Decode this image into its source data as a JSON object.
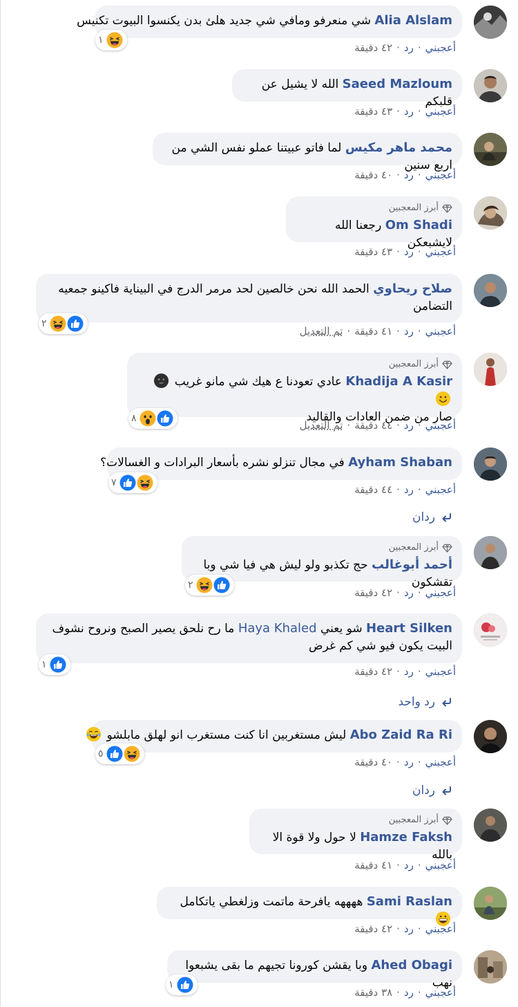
{
  "labels": {
    "top_fan": "أبرز المعجبين",
    "like": "أعجبني",
    "reply": "رد",
    "dot": "·",
    "edited": "تم التعديل"
  },
  "colors": {
    "link": "#385898",
    "bubble": "#f0f2f5",
    "meta": "#65676b",
    "like_blue": "#1877f2",
    "haha_yellow": "#f7b125"
  },
  "comments": [
    {
      "author": "Alia Alslam",
      "text": "شي منعرفو ومافي شي جديد هلئ بدن يكنسوا البيوت تكنيس",
      "time": "٤٢ دقيقة",
      "reactions": [
        "haha-icon"
      ],
      "count": "١"
    },
    {
      "author": "Saeed Mazloum",
      "text": "الله لا يشيل عن قلبكم",
      "time": "٤٣ دقيقة"
    },
    {
      "author": "محمد ماهر مكيس",
      "text": "لما فاتو عبيتنا عملو نفس الشي من اربع سنين",
      "time": "٤٠ دقيقة"
    },
    {
      "author": "Om Shadi",
      "text": "رجعنا الله لايشبعكن",
      "time": "٤٣ دقيقة",
      "top_fan": true
    },
    {
      "author": "صلاح ريحاوي",
      "text1": "الحمد الله نحن خالصين لحد مرمر الدرج في البيناية فاكينو جمعيه",
      "text2": "التضامن",
      "time": "٤١ دقيقة",
      "edited": true,
      "reactions": [
        "like-icon",
        "haha-icon"
      ],
      "count": "٢"
    },
    {
      "author": "Khadija A Kasir",
      "text1": "عادي تعودنا ع هيك شي مانو غريب",
      "text2": "صار من ضمن العادات والقاليد",
      "time": "٤٤ دقيقة",
      "edited": true,
      "top_fan": true,
      "reactions": [
        "like-icon",
        "wow-icon"
      ],
      "count": "٨",
      "emojis": [
        "dark-face-icon",
        "smile-face-icon"
      ]
    },
    {
      "author": "Ayham Shaban",
      "text": "في مجال تنزلو نشره بأسعار البرادات و الغسالات؟",
      "time": "٤٤ دقيقة",
      "reactions": [
        "haha-icon",
        "like-icon"
      ],
      "count": "٧",
      "replies": "ردان"
    },
    {
      "author": "أحمد أبوغالب",
      "text": "حج تكذبو ولو ليش هي فيا شي وبا تقشكون",
      "time": "٤٢ دقيقة",
      "top_fan": true,
      "reactions": [
        "like-icon",
        "haha-icon"
      ],
      "count": "٢"
    },
    {
      "author": "Heart Silken",
      "mention": "Haya Khaled",
      "text1": "شو يعني",
      "text1b": "ما رح نلحق يصير الصبح ونروح نشوف",
      "text2": "البيت يكون فيو شي كم غرض",
      "time": "٤٢ دقيقة",
      "reactions": [
        "like-icon"
      ],
      "count": "١",
      "replies": "رد واحد"
    },
    {
      "author": "Abo Zaid Ra Ri",
      "text": "ليش مستغربين انا كنت مستغرب انو لهلق مابلشو",
      "time": "٤٠ دقيقة",
      "reactions": [
        "haha-icon",
        "like-icon"
      ],
      "count": "٥",
      "emojis": [
        "tears-joy-icon"
      ],
      "replies": "ردان"
    },
    {
      "author": "Hamze Faksh",
      "text": "لا حول ولا قوة الا بالله",
      "time": "٤١ دقيقة",
      "top_fan": true
    },
    {
      "author": "Sami Raslan",
      "text": "ههههه يافرحة ماتمت وزلغطي ياتكامل",
      "time": "٤٢ دقيقة",
      "emojis": [
        "grin-icon"
      ]
    },
    {
      "author": "Ahed Obagi",
      "text": "وبا يقشن كورونا تجيهم ما بقى يشبعوا نهب",
      "time": "٣٨ دقيقة",
      "reactions": [
        "like-icon"
      ],
      "count": "١"
    }
  ]
}
